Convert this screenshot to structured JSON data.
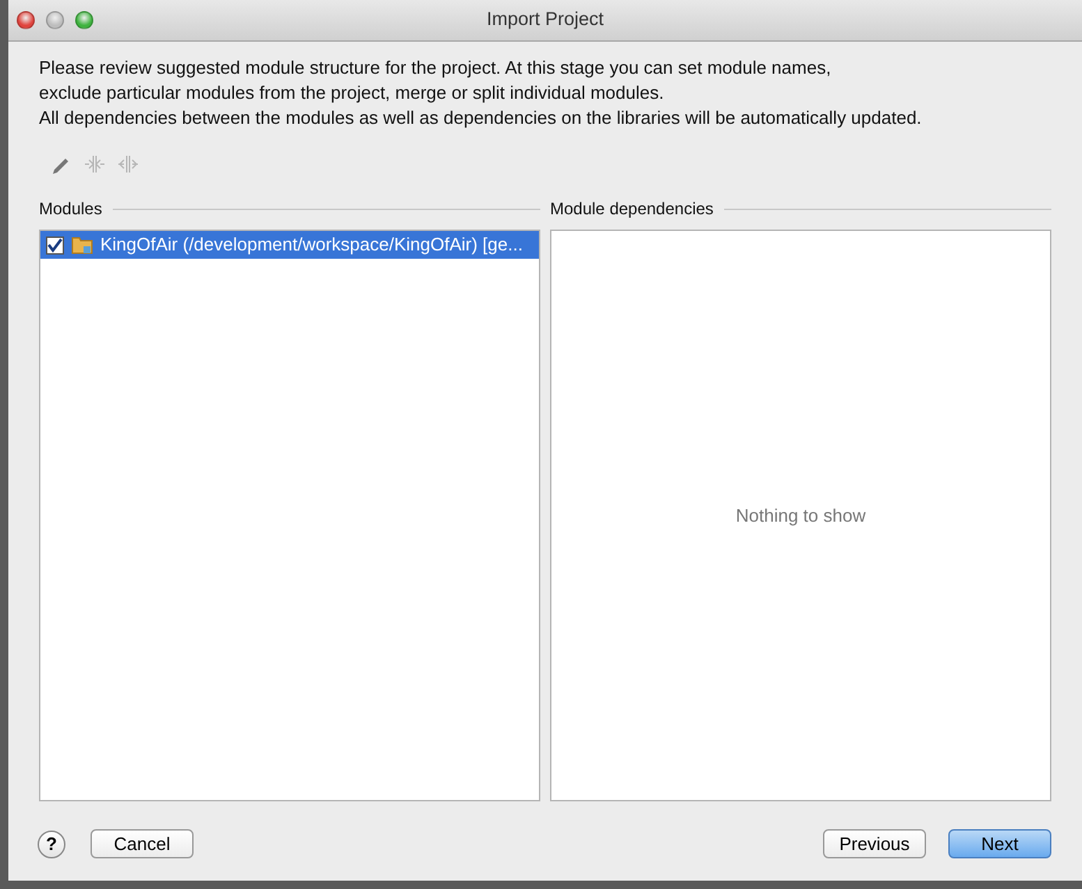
{
  "window": {
    "title": "Import Project"
  },
  "description": [
    "Please review suggested module structure for the project. At this stage you can set module names,",
    "exclude particular modules from the project, merge or split individual modules.",
    "All dependencies between the modules as well as dependencies on the libraries will be automatically updated."
  ],
  "toolbar": [
    {
      "kind": "edit",
      "disabled": false
    },
    {
      "kind": "merge",
      "disabled": true
    },
    {
      "kind": "split",
      "disabled": true
    }
  ],
  "modules": {
    "title": "Modules",
    "items": [
      {
        "label": "KingOfAir (/development/workspace/KingOfAir) [ge...",
        "checked": true,
        "selected": true
      }
    ]
  },
  "dependencies": {
    "title": "Module dependencies",
    "empty_text": "Nothing to show"
  },
  "buttons": {
    "help": "?",
    "cancel": "Cancel",
    "previous": "Previous",
    "next": "Next"
  }
}
